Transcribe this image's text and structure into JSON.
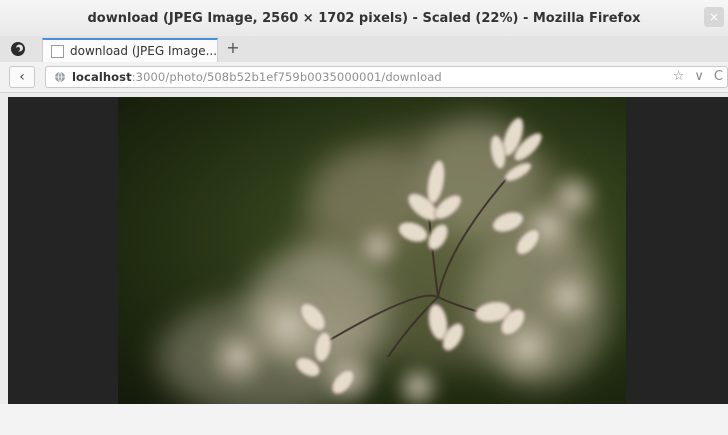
{
  "window": {
    "title": "download (JPEG Image, 2560 × 1702 pixels) - Scaled (22%) - Mozilla Firefox",
    "close_glyph": "×"
  },
  "tabs": [
    {
      "label": "download (JPEG Image...",
      "favicon": "page-icon",
      "active": true
    }
  ],
  "tabstrip": {
    "new_tab_glyph": "+",
    "app_icon": "firefox-icon"
  },
  "navbar": {
    "back_glyph": "‹",
    "url_host": "localhost",
    "url_path": ":3000/photo/508b52b1ef759b0035000001/download",
    "actions": {
      "star": "☆",
      "dropdown": "∨",
      "reload": "C"
    }
  },
  "content": {
    "image_alt": "download",
    "image_description_icon": "flower-photo",
    "background_color": "#242424"
  }
}
